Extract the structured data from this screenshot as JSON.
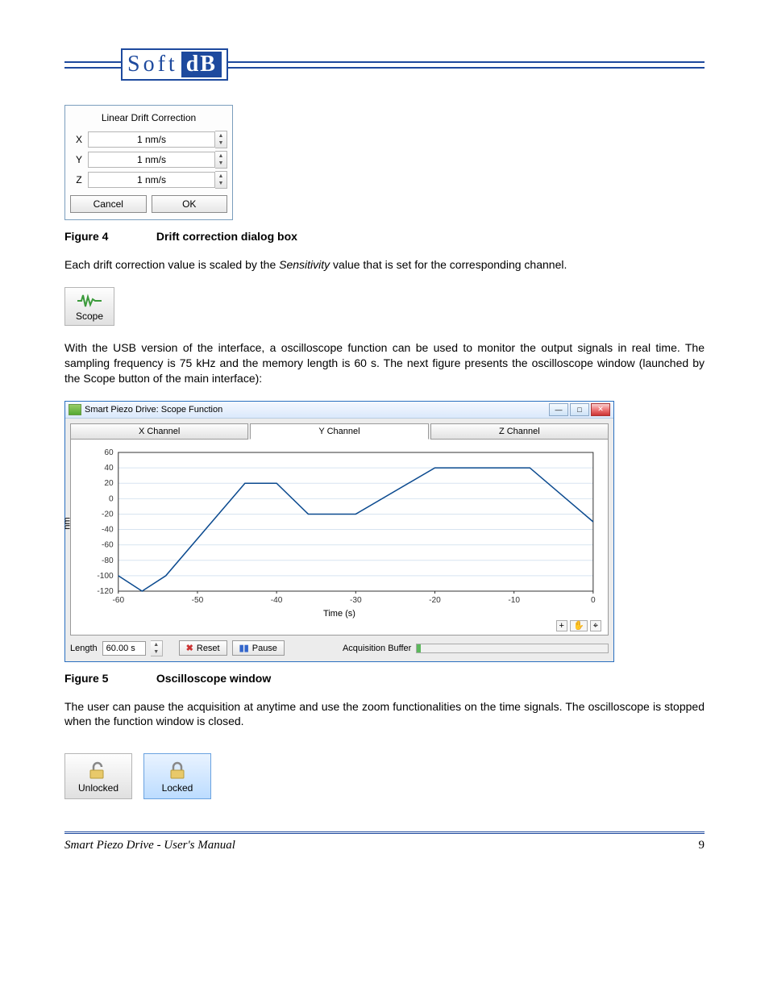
{
  "logo": {
    "soft": "Soft",
    "db": "dB"
  },
  "dialog": {
    "title": "Linear Drift Correction",
    "rows": [
      {
        "axis": "X",
        "value": "1 nm/s"
      },
      {
        "axis": "Y",
        "value": "1 nm/s"
      },
      {
        "axis": "Z",
        "value": "1 nm/s"
      }
    ],
    "cancel": "Cancel",
    "ok": "OK"
  },
  "fig4": {
    "num": "Figure 4",
    "title": "Drift correction dialog box"
  },
  "para1a": "Each drift correction value is scaled by the ",
  "para1b": "Sensitivity",
  "para1c": " value that is set for the corresponding channel.",
  "scope_btn": "Scope",
  "para2": "With the USB version of the interface, a oscilloscope function can be used to monitor the output signals in real time. The sampling frequency is 75 kHz and the memory length is 60 s. The next figure presents the oscilloscope window (launched by the Scope button of the main interface):",
  "scope_window": {
    "title": "Smart Piezo Drive: Scope Function",
    "tabs": [
      "X Channel",
      "Y Channel",
      "Z Channel"
    ],
    "active_tab": 1,
    "length_label": "Length",
    "length_value": "60.00 s",
    "reset": "Reset",
    "pause": "Pause",
    "buffer_label": "Acquisition Buffer",
    "xlabel": "Time (s)",
    "ylabel": "nm"
  },
  "chart_data": {
    "type": "line",
    "title": "",
    "xlabel": "Time (s)",
    "ylabel": "nm",
    "xlim": [
      -60,
      0
    ],
    "ylim": [
      -120,
      60
    ],
    "xticks": [
      -60,
      -50,
      -40,
      -30,
      -20,
      -10,
      0
    ],
    "yticks": [
      60,
      40,
      20,
      0,
      -20,
      -40,
      -60,
      -80,
      -100,
      -120
    ],
    "series": [
      {
        "name": "Y Channel",
        "x": [
          -60,
          -57,
          -54,
          -44,
          -40,
          -36,
          -30,
          -20,
          -15,
          -8,
          0
        ],
        "y": [
          -100,
          -120,
          -100,
          20,
          20,
          -20,
          -20,
          40,
          40,
          40,
          -30
        ]
      }
    ]
  },
  "fig5": {
    "num": "Figure 5",
    "title": "Oscilloscope window"
  },
  "para3": "The user can pause the acquisition at anytime and use the zoom functionalities on the time signals. The oscilloscope is stopped when the function window is closed.",
  "locks": {
    "unlocked": "Unlocked",
    "locked": "Locked"
  },
  "footer": {
    "text": "Smart Piezo Drive - User's Manual",
    "page": "9"
  }
}
